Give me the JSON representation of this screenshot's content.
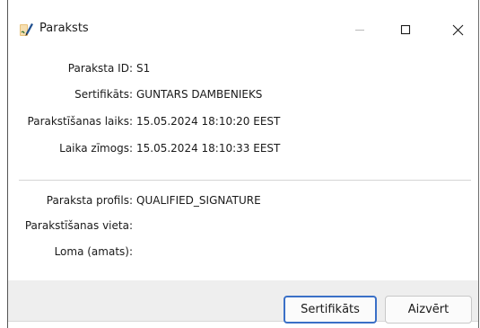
{
  "window": {
    "title": "Paraksts",
    "controls": {
      "minimize_icon": "minimize-icon",
      "maximize_icon": "maximize-icon",
      "close_icon": "close-icon"
    }
  },
  "fields_top": [
    {
      "label": "Paraksta ID:",
      "value": "S1"
    },
    {
      "label": "Sertifikāts:",
      "value": "GUNTARS DAMBENIEKS"
    },
    {
      "label": "Parakstīšanas laiks:",
      "value": "15.05.2024 18:10:20 EEST"
    },
    {
      "label": "Laika zīmogs:",
      "value": "15.05.2024 18:10:33 EEST"
    }
  ],
  "fields_bottom": [
    {
      "label": "Paraksta profils:",
      "value": "QUALIFIED_SIGNATURE"
    },
    {
      "label": "Parakstīšanas vieta:",
      "value": ""
    },
    {
      "label": "Loma (amats):",
      "value": ""
    }
  ],
  "buttons": {
    "certificate_label": "Sertifikāts",
    "close_label": "Aizvērt"
  },
  "colors": {
    "accent_border": "#3a70c7",
    "footer_bg": "#eeeeee"
  }
}
